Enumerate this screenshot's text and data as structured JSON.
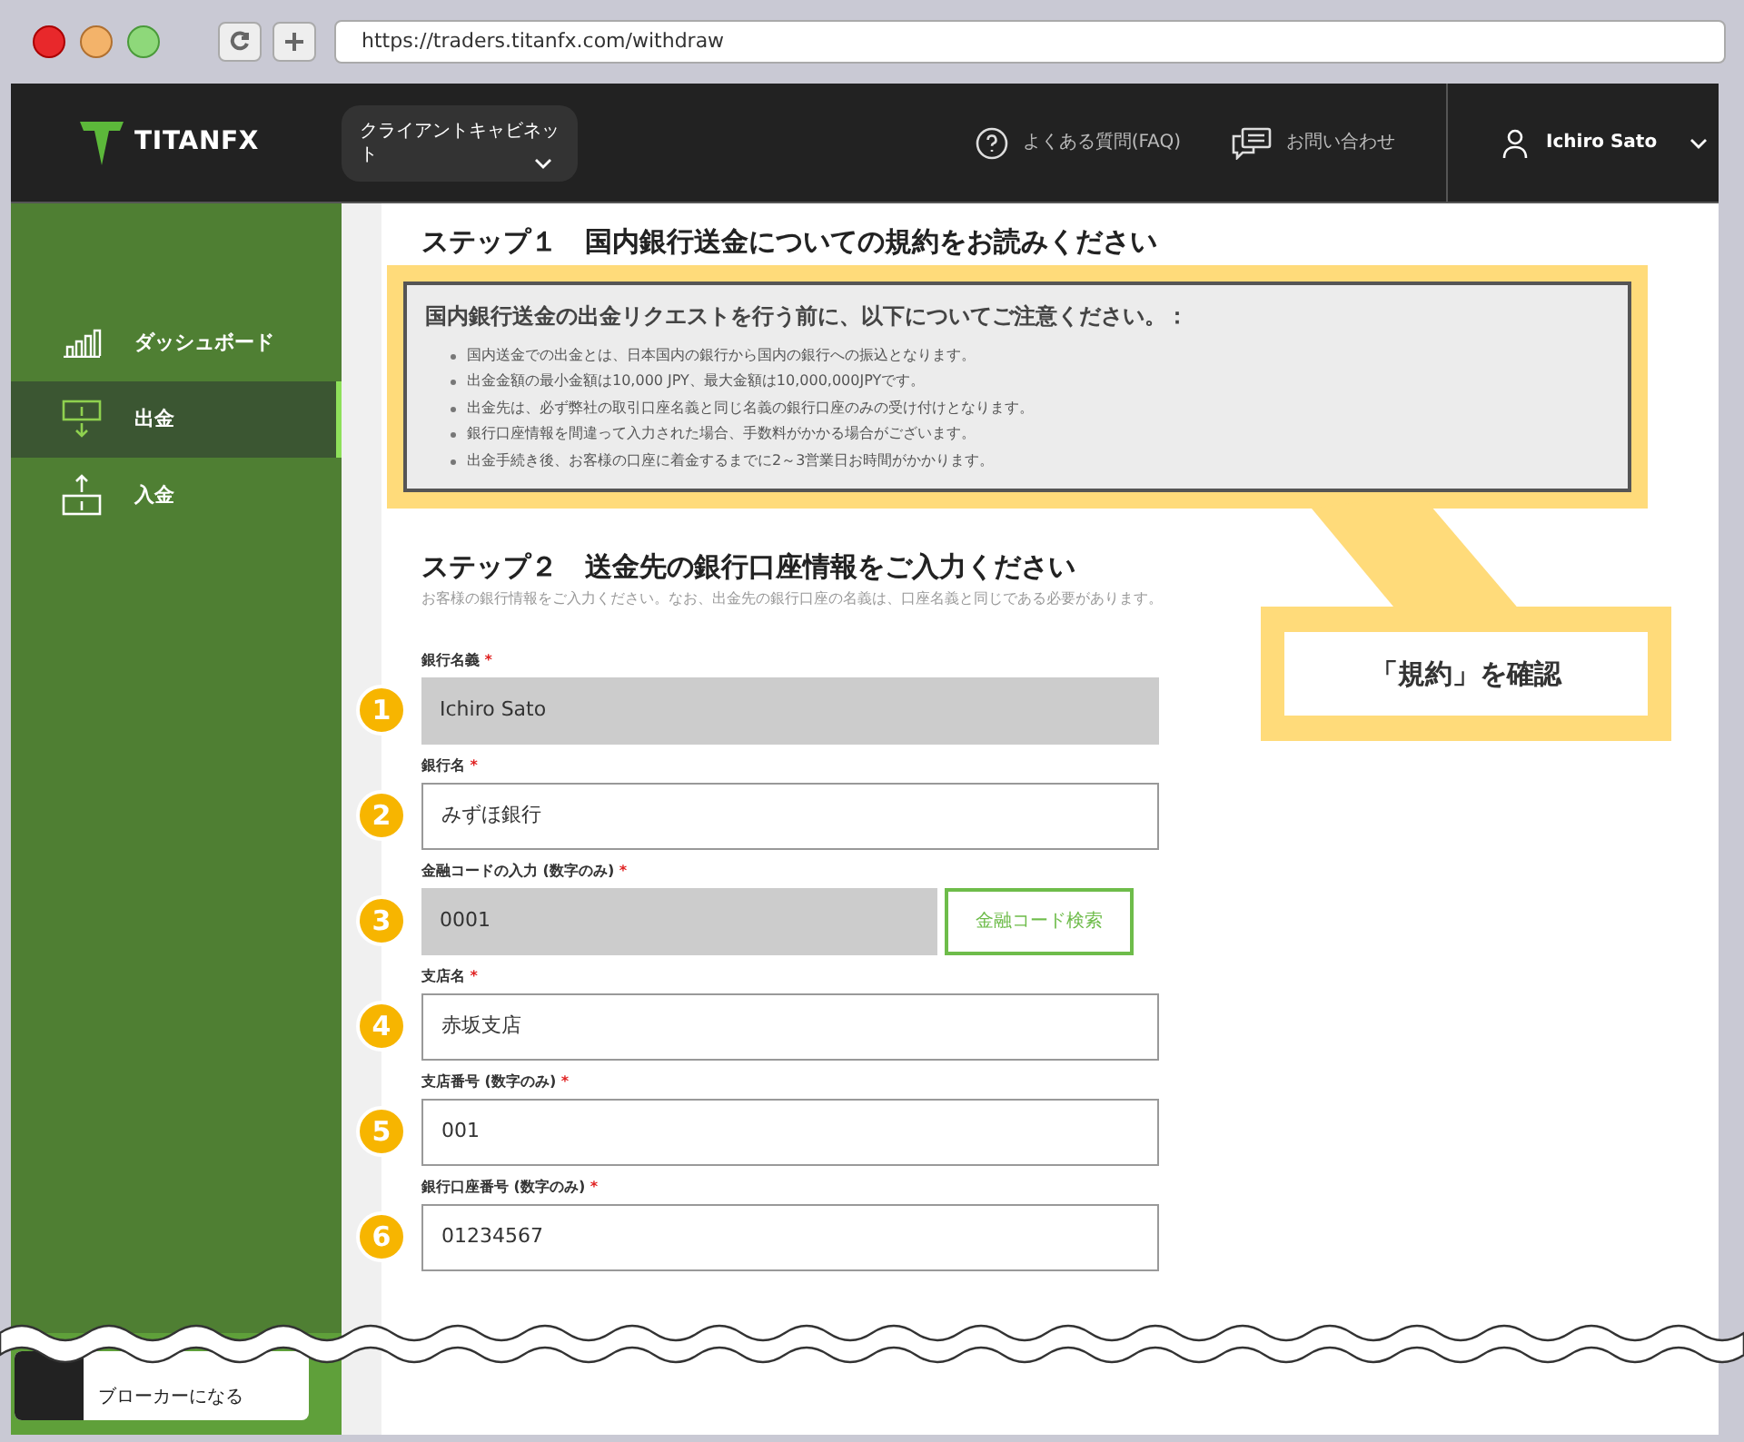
{
  "browser": {
    "url": "https://traders.titanfx.com/withdraw"
  },
  "header": {
    "logo": "TITANFX",
    "cabinet_menu": "クライアントキャビネット",
    "faq": "よくある質問(FAQ)",
    "contact": "お問い合わせ",
    "user": "Ichiro Sato"
  },
  "sidebar": {
    "items": [
      {
        "label": "ダッシュボード",
        "kind": "chart",
        "selected": false
      },
      {
        "label": "出金",
        "kind": "withdraw",
        "selected": true
      },
      {
        "label": "入金",
        "kind": "deposit",
        "selected": false
      }
    ],
    "promo": "ブローカーになる"
  },
  "step1": {
    "title": "ステップ１　国内銀行送金についての規約をお読みください",
    "notice_title": "国内銀行送金の出金リクエストを行う前に、以下についてご注意ください。：",
    "notes": [
      "国内送金での出金とは、日本国内の銀行から国内の銀行への振込となります。",
      "出金金額の最小金額は10,000 JPY、最大金額は10,000,000JPYです。",
      "出金先は、必ず弊社の取引口座名義と同じ名義の銀行口座のみの受け付けとなります。",
      "銀行口座情報を間違って入力された場合、手数料がかかる場合がございます。",
      "出金手続き後、お客様の口座に着金するまでに2～3営業日お時間がかかります。"
    ]
  },
  "step2": {
    "title": "ステップ２　送金先の銀行口座情報をご入力ください",
    "description": "お客様の銀行情報をご入力ください。なお、出金先の銀行口座の名義は、口座名義と同じである必要があります。"
  },
  "fields": [
    {
      "number": "1",
      "label": "銀行名義",
      "required": "*",
      "value": "Ichiro Sato",
      "disabled": true
    },
    {
      "number": "2",
      "label": "銀行名",
      "required": "*",
      "value": "みずほ銀行",
      "disabled": false
    },
    {
      "number": "3",
      "label": "金融コードの入力 (数字のみ)",
      "required": "*",
      "value": "0001",
      "disabled": true,
      "button": "金融コード検索"
    },
    {
      "number": "4",
      "label": "支店名",
      "required": "*",
      "value": "赤坂支店",
      "disabled": false
    },
    {
      "number": "5",
      "label": "支店番号 (数字のみ)",
      "required": "*",
      "value": "001",
      "disabled": false
    },
    {
      "number": "6",
      "label": "銀行口座番号 (数字のみ)",
      "required": "*",
      "value": "01234567",
      "disabled": false
    }
  ],
  "callout": "「規約」を確認"
}
